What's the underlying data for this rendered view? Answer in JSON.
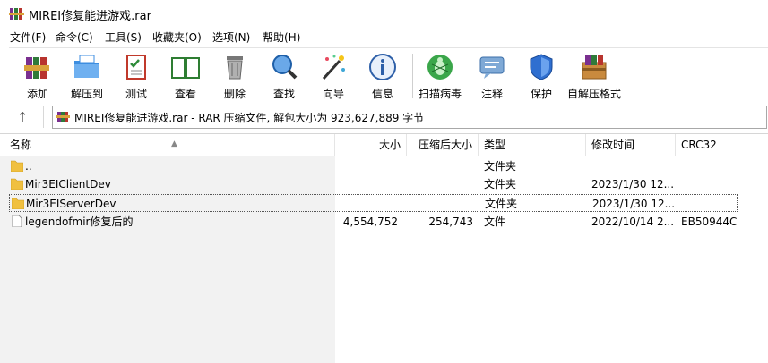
{
  "window": {
    "title": "MIREI修复能进游戏.rar",
    "app_icon": "winrar-books-icon"
  },
  "menu": [
    {
      "label": "文件(F)"
    },
    {
      "label": "命令(C)"
    },
    {
      "label": "工具(S)"
    },
    {
      "label": "收藏夹(O)"
    },
    {
      "label": "选项(N)"
    },
    {
      "label": "帮助(H)"
    }
  ],
  "toolbar": [
    {
      "label": "添加",
      "icon": "add-icon"
    },
    {
      "label": "解压到",
      "icon": "extract-to-icon"
    },
    {
      "label": "测试",
      "icon": "test-icon"
    },
    {
      "label": "查看",
      "icon": "view-icon"
    },
    {
      "label": "删除",
      "icon": "delete-icon"
    },
    {
      "label": "查找",
      "icon": "find-icon"
    },
    {
      "label": "向导",
      "icon": "wizard-icon"
    },
    {
      "label": "信息",
      "icon": "info-icon"
    },
    {
      "label": "扫描病毒",
      "icon": "virus-scan-icon"
    },
    {
      "label": "注释",
      "icon": "comment-icon"
    },
    {
      "label": "保护",
      "icon": "protect-icon"
    },
    {
      "label": "自解压格式",
      "icon": "sfx-icon"
    }
  ],
  "address": {
    "up_label": "↑",
    "text": "MIREI修复能进游戏.rar - RAR 压缩文件, 解包大小为 923,627,889 字节"
  },
  "columns": [
    "名称",
    "大小",
    "压缩后大小",
    "类型",
    "修改时间",
    "CRC32"
  ],
  "files": [
    {
      "name": "..",
      "size": "",
      "packed": "",
      "type": "文件夹",
      "modified": "",
      "crc": "",
      "kind": "folder"
    },
    {
      "name": "Mir3EIClientDev",
      "size": "",
      "packed": "",
      "type": "文件夹",
      "modified": "2023/1/30 12...",
      "crc": "",
      "kind": "folder"
    },
    {
      "name": "Mir3EIServerDev",
      "size": "",
      "packed": "",
      "type": "文件夹",
      "modified": "2023/1/30 12...",
      "crc": "",
      "kind": "folder"
    },
    {
      "name": "legendofmir修复后的",
      "size": "4,554,752",
      "packed": "254,743",
      "type": "文件",
      "modified": "2022/10/14 2...",
      "crc": "EB50944C",
      "kind": "file"
    }
  ],
  "colors": {
    "folder": "#f0c040",
    "accent": "#1e6fd0"
  }
}
